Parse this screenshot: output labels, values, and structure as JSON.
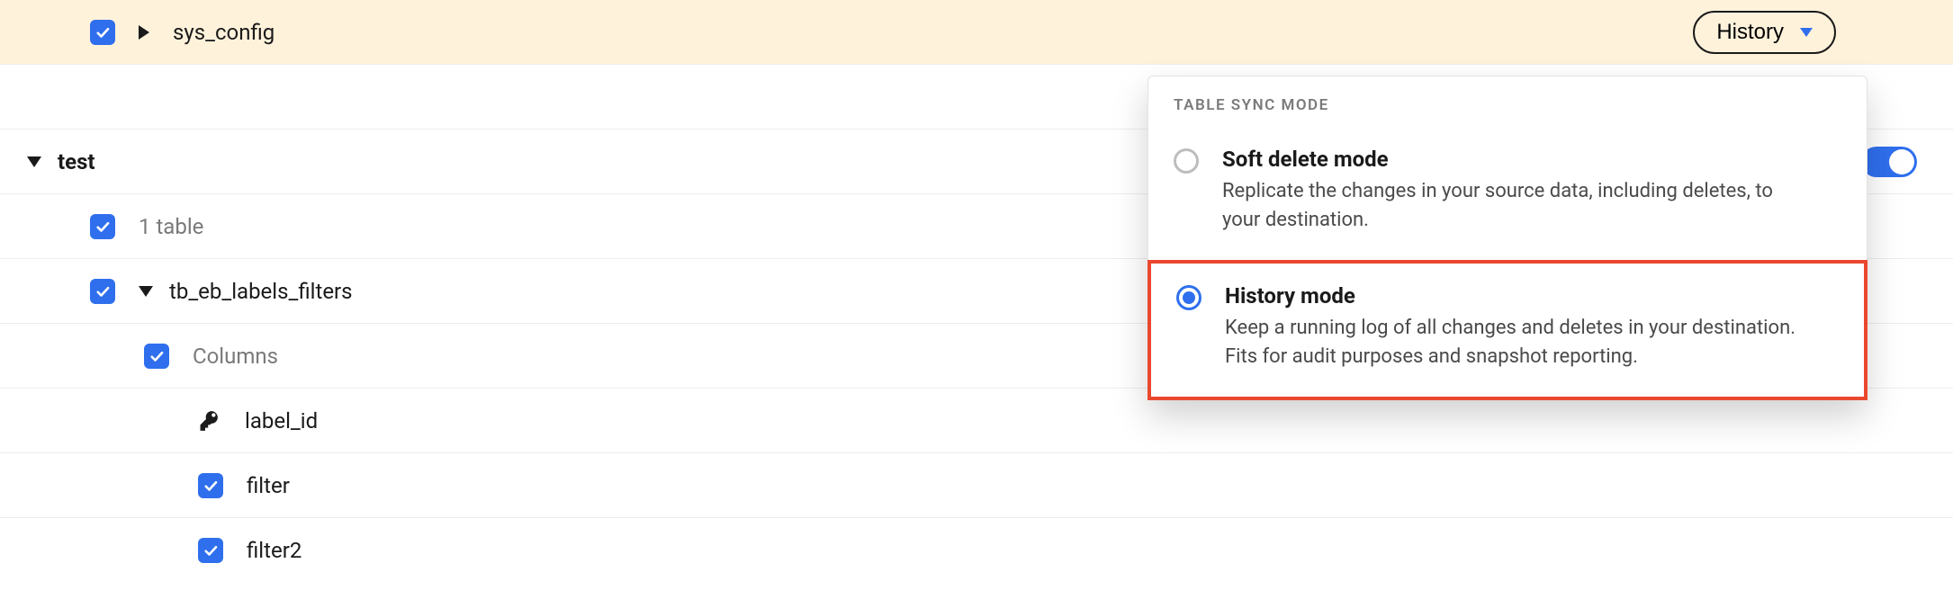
{
  "rows": {
    "sys_config": "sys_config",
    "schema_test": "test",
    "table_count": "1 table",
    "tb_eb": "tb_eb_labels_filters",
    "columns": "Columns",
    "label_id": "label_id",
    "filter": "filter",
    "filter2": "filter2"
  },
  "history_button": "History",
  "popover": {
    "header": "TABLE SYNC MODE",
    "options": [
      {
        "title": "Soft delete mode",
        "desc": "Replicate the changes in your source data, including deletes, to your destination."
      },
      {
        "title": "History mode",
        "desc": "Keep a running log of all changes and deletes in your destination. Fits for audit purposes and snapshot reporting."
      }
    ]
  }
}
